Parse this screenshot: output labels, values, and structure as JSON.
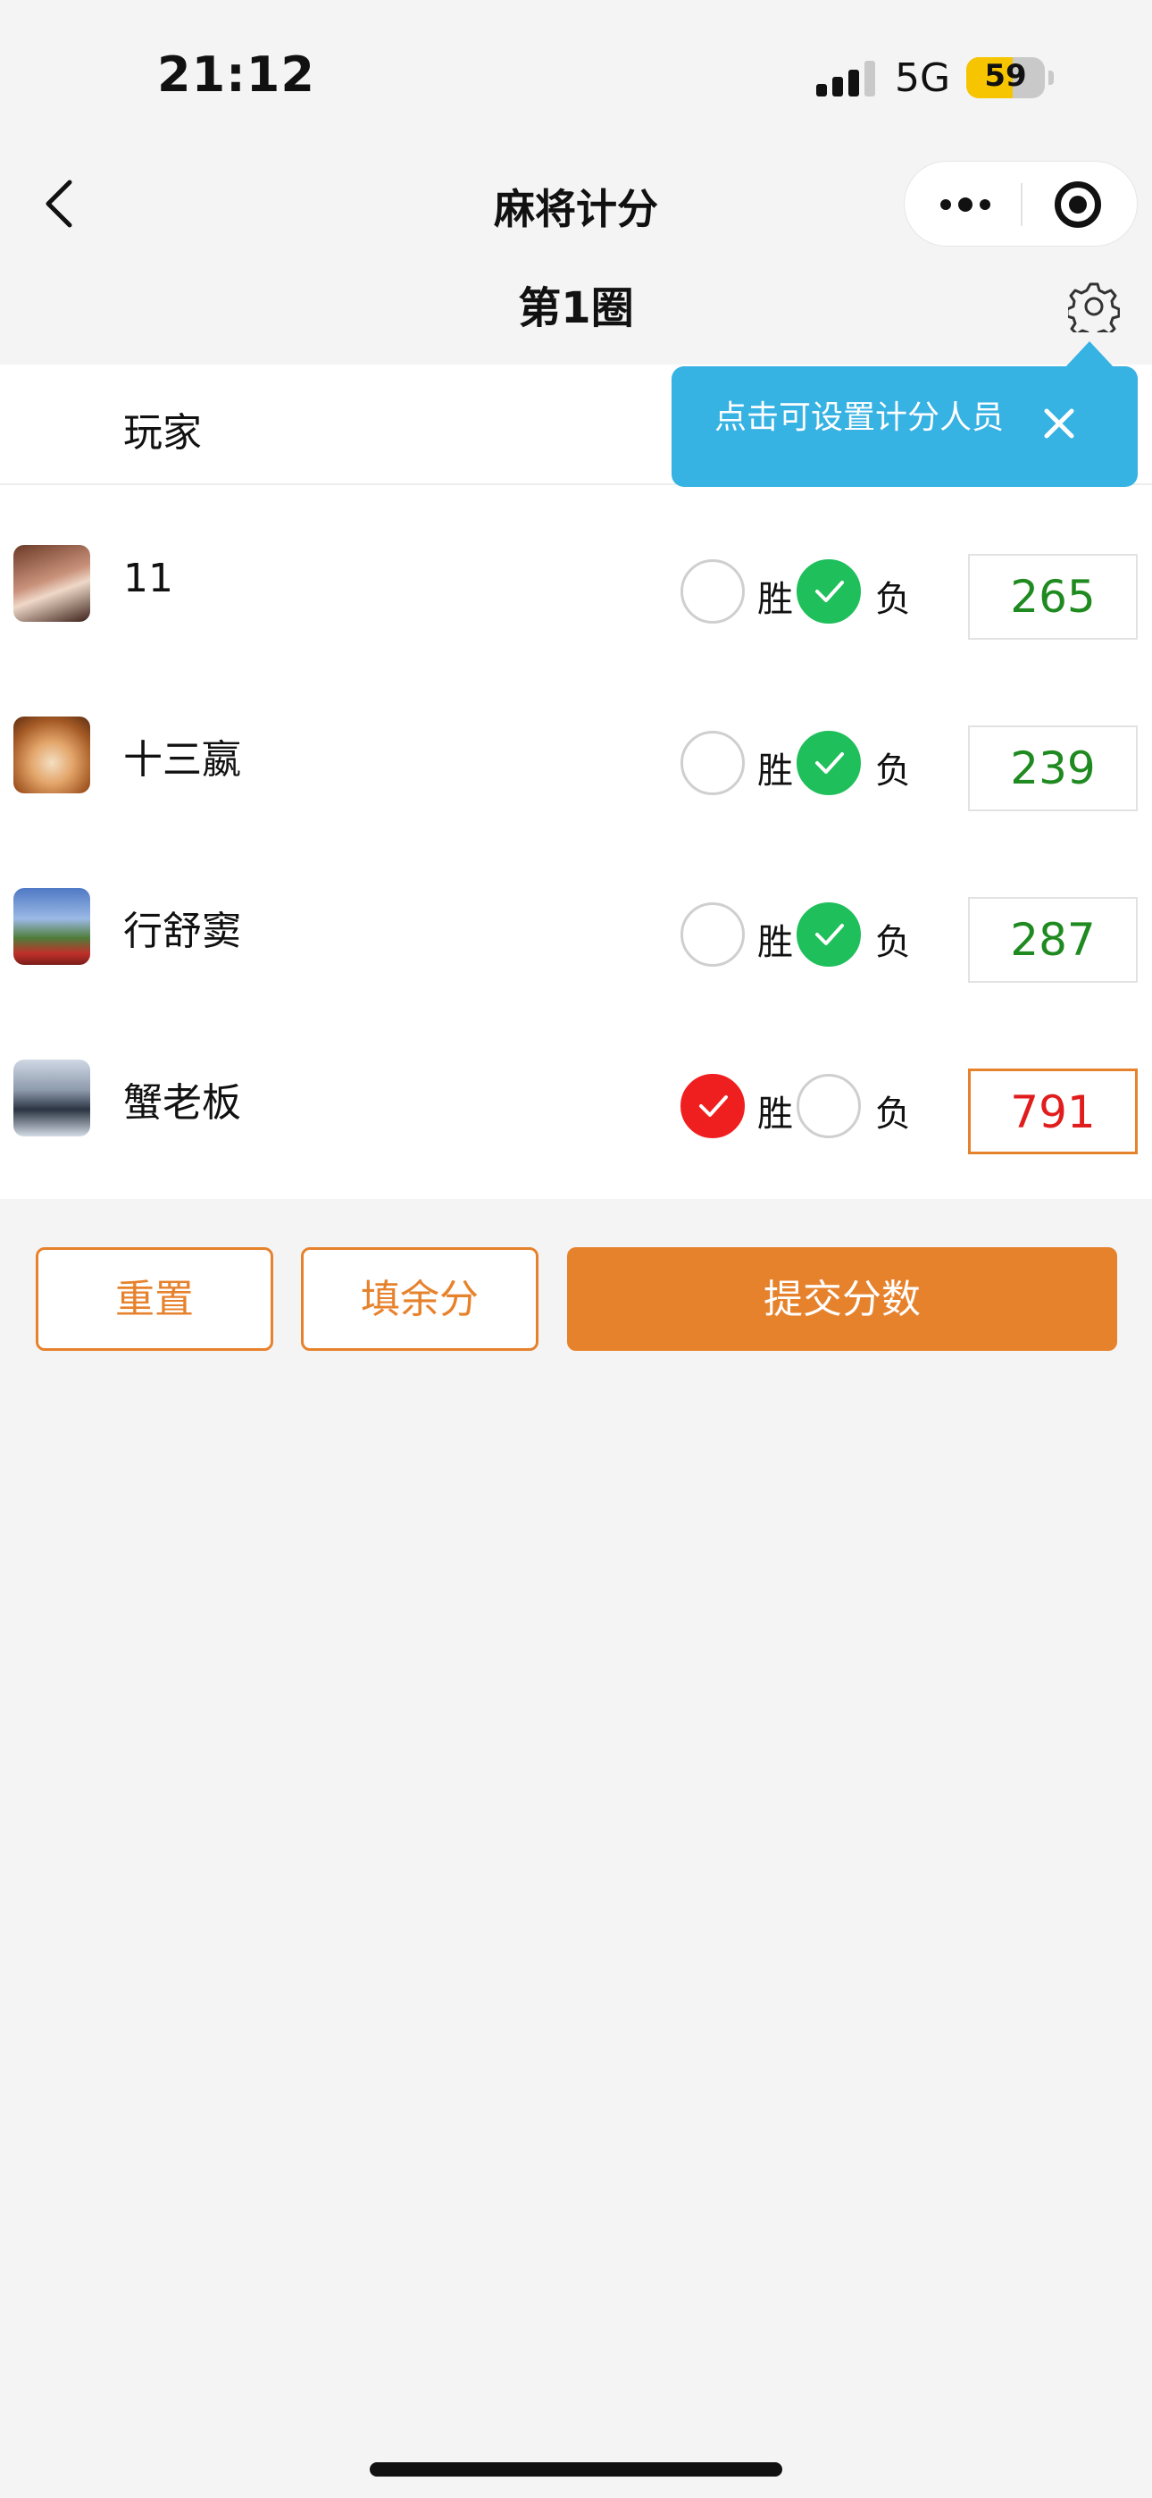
{
  "status_bar": {
    "time": "21:12",
    "network": "5G",
    "battery_level": "59",
    "battery_fraction": 0.59
  },
  "nav": {
    "title": "麻将计分",
    "back_icon": "chevron-left-icon",
    "more_icon": "more-dots-icon",
    "close_icon": "target-icon"
  },
  "round": {
    "title": "第1圈",
    "settings_icon": "gear-icon"
  },
  "tooltip": {
    "text": "点击可设置计分人员",
    "close_icon": "close-icon"
  },
  "table": {
    "header_player": "玩家",
    "win_label": "胜",
    "lose_label": "负",
    "players": [
      {
        "name": "11",
        "result": "lose",
        "score": "265"
      },
      {
        "name": "十三嬴",
        "result": "lose",
        "score": "239"
      },
      {
        "name": "行舒窦",
        "result": "lose",
        "score": "287"
      },
      {
        "name": "蟹老板",
        "result": "win",
        "score": "791"
      }
    ]
  },
  "actions": {
    "reset": "重置",
    "fill_remaining": "填余分",
    "submit": "提交分数"
  },
  "colors": {
    "accent": "#e7822c",
    "win": "#f01f1f",
    "lose": "#1fbf5b",
    "tooltip": "#36b2e3"
  }
}
